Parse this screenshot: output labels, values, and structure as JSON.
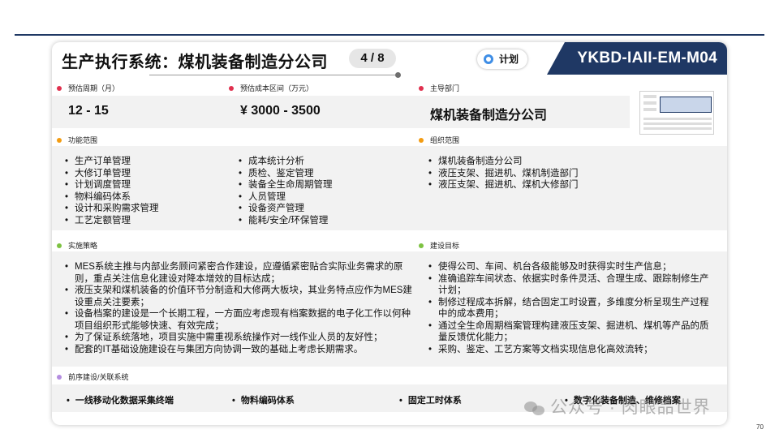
{
  "header": {
    "title": "生产执行系统：煤机装备制造分公司",
    "pager": "4 / 8",
    "status_label": "计划",
    "code": "YKBD-IAII-EM-M04"
  },
  "fields": {
    "period": {
      "label": "预估周期（月）",
      "value": "12 - 15",
      "dot_color": "#e0304e"
    },
    "cost": {
      "label": "预估成本区间（万元）",
      "value": "¥ 3000 - 3500",
      "dot_color": "#e0304e"
    },
    "dept": {
      "label": "主导部门",
      "value": "煤机装备制造分公司",
      "dot_color": "#e0304e"
    }
  },
  "function_scope": {
    "label": "功能范围",
    "dot_color": "#f39c12",
    "col1": [
      "生产订单管理",
      "大修订单管理",
      "计划调度管理",
      "物料编码体系",
      "设计和采购需求管理",
      "工艺定额管理"
    ],
    "col2": [
      "成本统计分析",
      "质检、鉴定管理",
      "装备全生命周期管理",
      "人员管理",
      "设备资产管理",
      "能耗/安全/环保管理"
    ]
  },
  "org_scope": {
    "label": "组织范围",
    "dot_color": "#f39c12",
    "items": [
      "煤机装备制造分公司",
      "液压支架、掘进机、煤机制造部门",
      "液压支架、掘进机、煤机大修部门"
    ]
  },
  "strategy": {
    "label": "实施策略",
    "dot_color": "#7dc242",
    "items": [
      "MES系统主推与内部业务顾问紧密合作建设，应遵循紧密贴合实际业务需求的原则，重点关注信息化建设对降本增效的目标达成；",
      "液压支架和煤机装备的价值环节分制造和大修两大板块，其业务特点应作为MES建设重点关注要素；",
      "设备档案的建设是一个长期工程，一方面应考虑现有档案数据的电子化工作以何种项目组织形式能够快速、有效完成；",
      "为了保证系统落地，项目实施中需重视系统操作对一线作业人员的友好性；",
      "配套的IT基础设施建设在与集团方向协调一致的基础上考虑长期需求。"
    ]
  },
  "goals": {
    "label": "建设目标",
    "dot_color": "#7dc242",
    "items": [
      "使得公司、车间、机台各级能够及时获得实时生产信息；",
      "准确追踪车间状态、依据实时条件灵活、合理生成、跟踪制修生产计划；",
      "制修过程成本拆解，结合固定工时设置，多维度分析呈现生产过程中的成本费用；",
      "通过全生命周期档案管理构建液压支架、掘进机、煤机等产品的质量反馈优化能力；",
      "采购、鉴定、工艺方案等文档实现信息化高效流转；"
    ]
  },
  "related": {
    "label": "前序建设/关联系统",
    "dot_color": "#b48de0",
    "items": [
      "一线移动化数据采集终端",
      "物料编码体系",
      "固定工时体系",
      "数字化装备制造、维修档案"
    ]
  },
  "watermark": "公众号 · 肉眼品世界",
  "page_number": "70",
  "colors": {
    "navy": "#1f3864",
    "band": "#f2f2f2",
    "ring": "#3f8ee6"
  }
}
